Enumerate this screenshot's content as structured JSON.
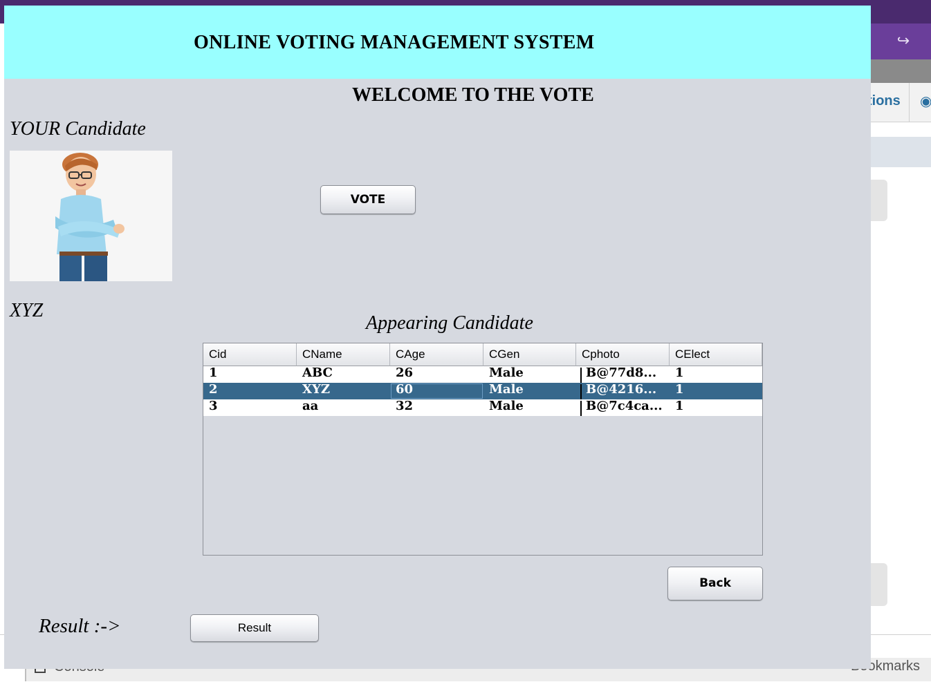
{
  "background": {
    "tab_label": "tions",
    "console_label": "Console",
    "bookmarks_label": "Bookmarks",
    "icons": [
      "share-icon",
      "eye-icon",
      "console-icon"
    ]
  },
  "app": {
    "title": "ONLINE VOTING MANAGEMENT SYSTEM",
    "welcome": "WELCOME TO THE VOTE",
    "your_candidate_label": "YOUR Candidate",
    "candidate_name": "XYZ",
    "vote_button": "VOTE",
    "appearing_label": "Appearing Candidate",
    "back_button": "Back",
    "result_label": "Result  :->",
    "result_button": "Result",
    "colors": {
      "header_band": "#99ffff",
      "frame_bg": "#d6d9e0",
      "selected_row": "#37688c"
    }
  },
  "table": {
    "columns": [
      "Cid",
      "CName",
      "CAge",
      "CGen",
      "Cphoto",
      "CElect"
    ],
    "rows": [
      [
        "1",
        "ABC",
        "26",
        "Male",
        "B@77d8...",
        "1"
      ],
      [
        "2",
        "XYZ",
        "60",
        "Male",
        "B@4216...",
        "1"
      ],
      [
        "3",
        "aa",
        "32",
        "Male",
        "B@7c4ca...",
        "1"
      ]
    ],
    "selected_row_index": 1
  }
}
